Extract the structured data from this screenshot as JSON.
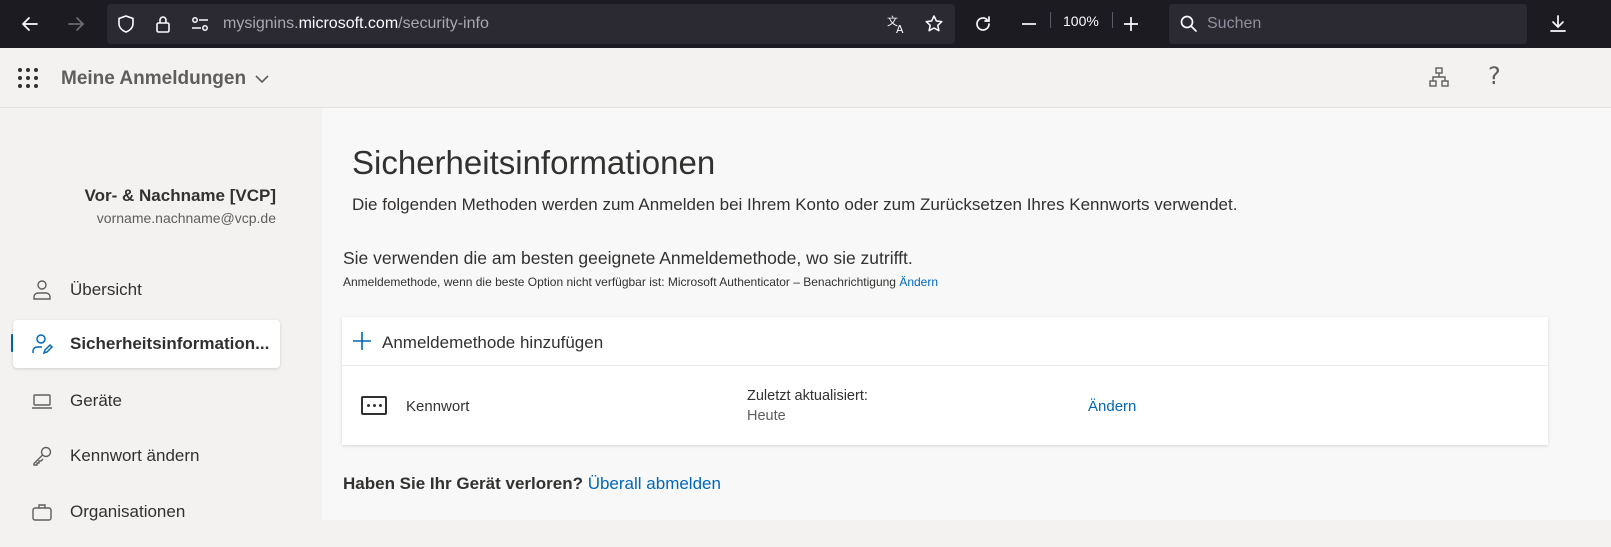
{
  "browser": {
    "url_prefix": "mysignins.",
    "url_host": "microsoft.com",
    "url_path": "/security-info",
    "zoom": "100%",
    "search_placeholder": "Suchen"
  },
  "header": {
    "app_title": "Meine Anmeldungen"
  },
  "sidebar": {
    "user_name": "Vor- & Nachname [VCP]",
    "user_email": "vorname.nachname@vcp.de",
    "items": [
      {
        "label": "Übersicht"
      },
      {
        "label": "Sicherheitsinformation..."
      },
      {
        "label": "Geräte"
      },
      {
        "label": "Kennwort ändern"
      },
      {
        "label": "Organisationen"
      }
    ]
  },
  "main": {
    "title": "Sicherheitsinformationen",
    "description": "Die folgenden Methoden werden zum Anmelden bei Ihrem Konto oder zum Zurücksetzen Ihres Kennworts verwendet.",
    "default_heading": "Sie verwenden die am besten geeignete Anmeldemethode, wo sie zutrifft.",
    "default_sub": "Anmeldemethode, wenn die beste Option nicht verfügbar ist: Microsoft Authenticator – Benachrichtigung",
    "default_change_link": "Ändern",
    "add_method_label": "Anmeldemethode hinzufügen",
    "methods": [
      {
        "name": "Kennwort",
        "updated_label": "Zuletzt aktualisiert:",
        "updated_value": "Heute",
        "action": "Ändern"
      }
    ],
    "lost_device_question": "Haben Sie Ihr Gerät verloren?",
    "lost_device_link": "Überall abmelden"
  },
  "colors": {
    "accent": "#0067b8",
    "browser_toolbar": "#1c1b22",
    "page_bg": "#f3f2f1"
  }
}
